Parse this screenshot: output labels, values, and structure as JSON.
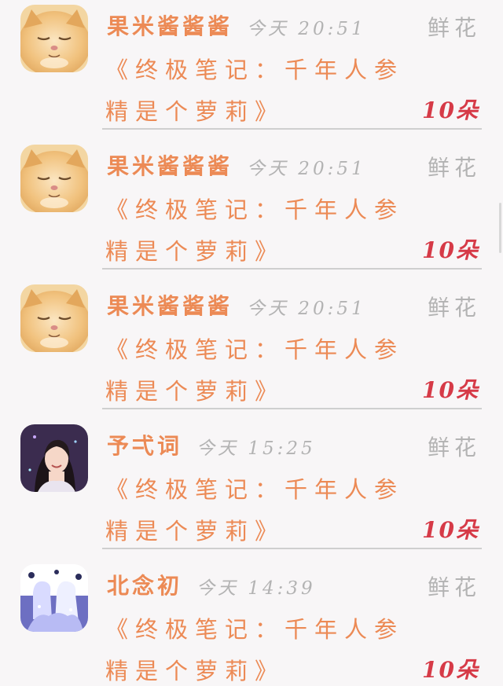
{
  "colors": {
    "accent": "#ec8a55",
    "muted": "#b3b3b3",
    "count": "#d63a47",
    "divider": "#cfcfcf",
    "background": "#f8f6f7"
  },
  "gift_list": [
    {
      "username": "果米酱酱酱",
      "time": "今天 20:51",
      "gift_name": "鲜花",
      "message_line1": "《终极笔记：千年人参",
      "message_line2": "精是个萝莉》",
      "count": "10朵",
      "avatar_icon": "kitten-avatar-icon"
    },
    {
      "username": "果米酱酱酱",
      "time": "今天 20:51",
      "gift_name": "鲜花",
      "message_line1": "《终极笔记：千年人参",
      "message_line2": "精是个萝莉》",
      "count": "10朵",
      "avatar_icon": "kitten-avatar-icon"
    },
    {
      "username": "果米酱酱酱",
      "time": "今天 20:51",
      "gift_name": "鲜花",
      "message_line1": "《终极笔记：千年人参",
      "message_line2": "精是个萝莉》",
      "count": "10朵",
      "avatar_icon": "kitten-avatar-icon"
    },
    {
      "username": "予弌词",
      "time": "今天 15:25",
      "gift_name": "鲜花",
      "message_line1": "《终极笔记：千年人参",
      "message_line2": "精是个萝莉》",
      "count": "10朵",
      "avatar_icon": "woman-portrait-avatar-icon"
    },
    {
      "username": "北念初",
      "time": "今天 14:39",
      "gift_name": "鲜花",
      "message_line1": "《终极笔记：千年人参",
      "message_line2": "精是个萝莉》",
      "count": "10朵",
      "avatar_icon": "anime-characters-avatar-icon"
    }
  ]
}
